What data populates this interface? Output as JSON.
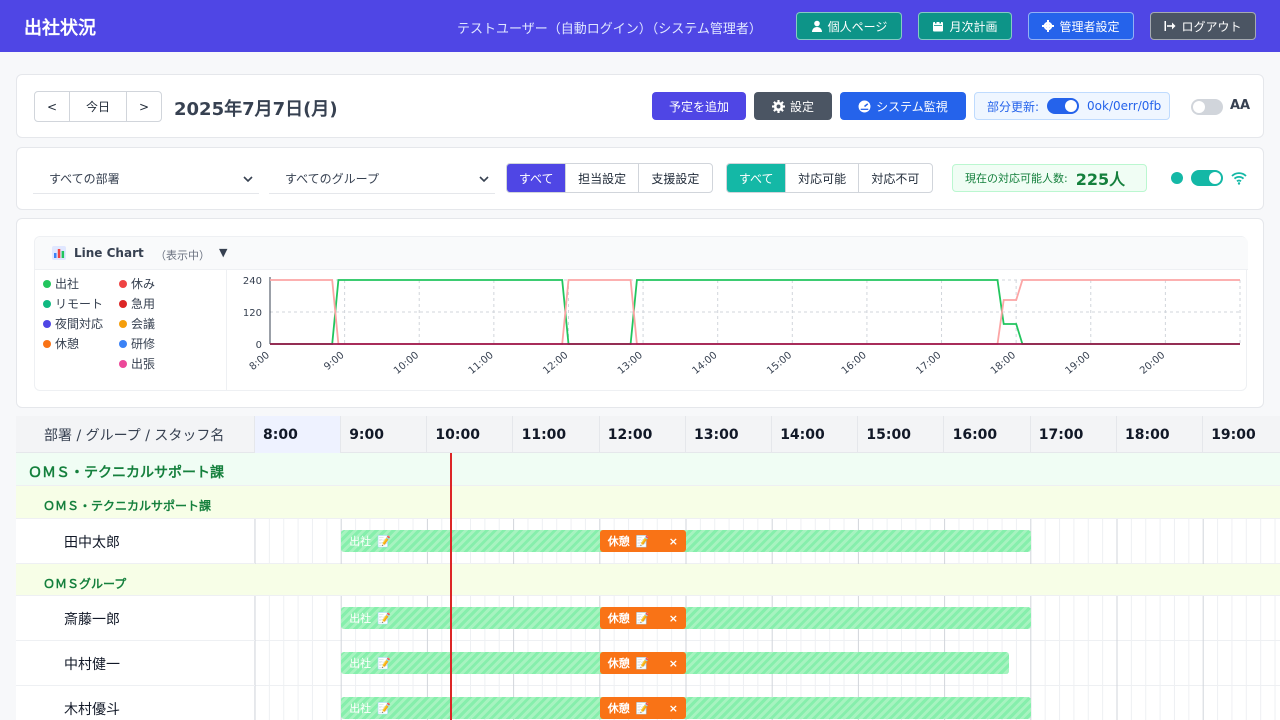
{
  "header": {
    "app_title": "出社状況",
    "user": "テストユーザー（自動ログイン）（システム管理者）",
    "personal_page": "個人ページ",
    "monthly_plan": "月次計画",
    "admin_settings": "管理者設定",
    "logout": "ログアウト"
  },
  "toolbar": {
    "prev": "<",
    "today": "今日",
    "next": ">",
    "date": "2025年7月7日(月)",
    "add_schedule": "予定を追加",
    "settings": "設定",
    "system_monitor": "システム監視",
    "partial_update_label": "部分更新:",
    "partial_update_status": "0ok/0err/0fb",
    "partial_update_on": true,
    "dark_mode_on": false,
    "font_size_icon": "AA"
  },
  "filters": {
    "department": "すべての部署",
    "group": "すべてのグループ",
    "scope_options": [
      "すべて",
      "担当設定",
      "支援設定"
    ],
    "scope_selected": "すべて",
    "availability_options": [
      "すべて",
      "対応可能",
      "対応不可"
    ],
    "availability_selected": "すべて",
    "available_label": "現在の対応可能人数:",
    "available_count": "225人",
    "realtime_on": true
  },
  "chart_panel": {
    "title": "Line Chart",
    "state": "（表示中）",
    "caret": "▼",
    "legend": [
      {
        "name": "出社",
        "color": "#22c55e"
      },
      {
        "name": "休み",
        "color": "#ef4444"
      },
      {
        "name": "リモート",
        "color": "#10b981"
      },
      {
        "name": "急用",
        "color": "#dc2626"
      },
      {
        "name": "夜間対応",
        "color": "#4f46e5"
      },
      {
        "name": "会議",
        "color": "#f59e0b"
      },
      {
        "name": "休憩",
        "color": "#f97316"
      },
      {
        "name": "研修",
        "color": "#3b82f6"
      },
      {
        "name": "出張",
        "color": "#ec4899"
      }
    ]
  },
  "chart_data": {
    "type": "line",
    "x_ticks": [
      "8:00",
      "9:00",
      "10:00",
      "11:00",
      "12:00",
      "13:00",
      "14:00",
      "15:00",
      "16:00",
      "17:00",
      "18:00",
      "19:00",
      "20:00"
    ],
    "y_ticks": [
      0,
      120,
      240
    ],
    "ylim": [
      0,
      240
    ],
    "xlim": [
      "8:00",
      "21:00"
    ],
    "grid": true,
    "series": [
      {
        "name": "出社",
        "color": "#22c55e",
        "points": [
          [
            "8:00",
            0
          ],
          [
            "8:50",
            0
          ],
          [
            "8:55",
            240
          ],
          [
            "11:55",
            240
          ],
          [
            "12:00",
            0
          ],
          [
            "12:50",
            0
          ],
          [
            "12:55",
            240
          ],
          [
            "17:45",
            240
          ],
          [
            "17:50",
            75
          ],
          [
            "18:00",
            75
          ],
          [
            "18:05",
            0
          ],
          [
            "21:00",
            0
          ]
        ]
      },
      {
        "name": "休憩",
        "color": "#fca5a5",
        "points": [
          [
            "8:00",
            240
          ],
          [
            "8:50",
            240
          ],
          [
            "8:55",
            0
          ],
          [
            "11:55",
            0
          ],
          [
            "12:00",
            240
          ],
          [
            "12:50",
            240
          ],
          [
            "12:55",
            0
          ],
          [
            "17:45",
            0
          ],
          [
            "17:50",
            165
          ],
          [
            "18:00",
            165
          ],
          [
            "18:05",
            240
          ],
          [
            "21:00",
            240
          ]
        ]
      },
      {
        "name": "夜間対応",
        "color": "#9d174d",
        "points": [
          [
            "8:00",
            0
          ],
          [
            "21:00",
            0
          ]
        ]
      }
    ]
  },
  "timeline": {
    "header_label": "部署 / グループ / スタッフ名",
    "hours": [
      "8:00",
      "9:00",
      "10:00",
      "11:00",
      "12:00",
      "13:00",
      "14:00",
      "15:00",
      "16:00",
      "17:00",
      "18:00",
      "19:00"
    ],
    "department": "ＯＭＳ・テクニカルサポート課",
    "groups": [
      {
        "name": "ＯＭＳ・テクニカルサポート課",
        "staff": [
          {
            "name": "田中太郎",
            "work_label": "出社",
            "break_label": "休憩"
          }
        ]
      },
      {
        "name": "ＯＭＳグループ",
        "staff": [
          {
            "name": "斎藤一郎",
            "work_label": "出社",
            "break_label": "休憩"
          },
          {
            "name": "中村健一",
            "work_label": "出社",
            "break_label": "休憩"
          },
          {
            "name": "木村優斗",
            "work_label": "出社",
            "break_label": "休憩"
          }
        ]
      }
    ],
    "remove_icon": "×"
  }
}
